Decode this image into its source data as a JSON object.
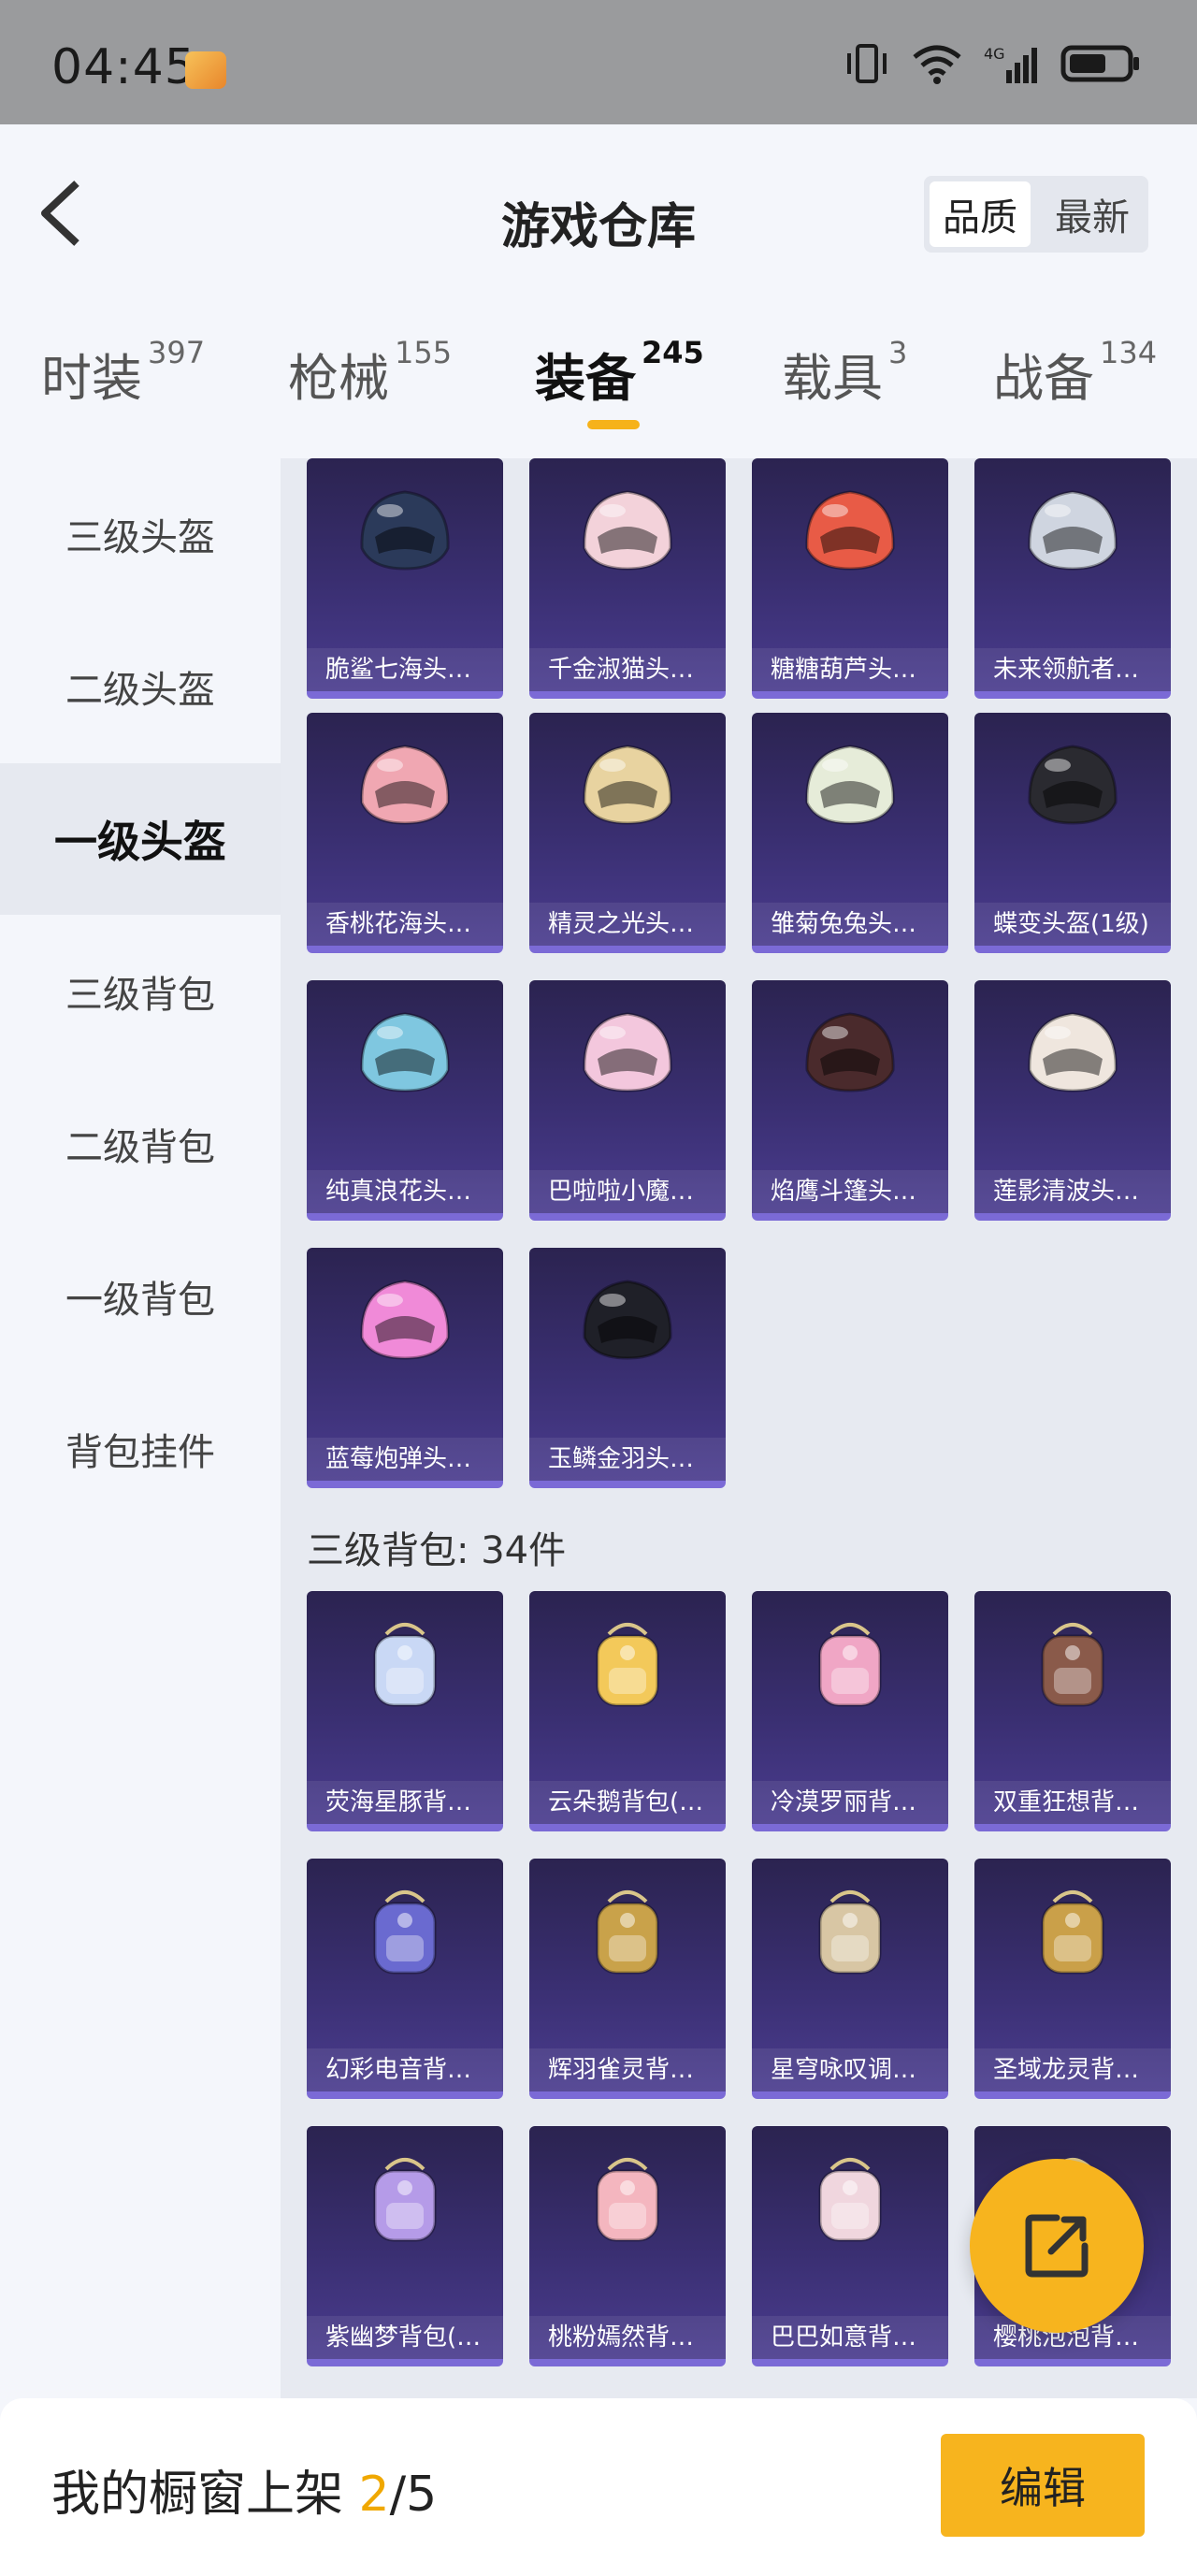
{
  "status_bar": {
    "time": "04:45"
  },
  "header": {
    "title": "游戏仓库",
    "sort_options": [
      "品质",
      "最新"
    ]
  },
  "tabs": [
    {
      "label": "时装",
      "count": "397"
    },
    {
      "label": "枪械",
      "count": "155"
    },
    {
      "label": "装备",
      "count": "245"
    },
    {
      "label": "载具",
      "count": "3"
    },
    {
      "label": "战备",
      "count": "134"
    }
  ],
  "sidebar": {
    "items": [
      "三级头盔",
      "二级头盔",
      "一级头盔",
      "三级背包",
      "二级背包",
      "一级背包",
      "背包挂件"
    ]
  },
  "helmets": [
    {
      "name": "脆鲨七海头…",
      "color": "#2b3a5a"
    },
    {
      "name": "千金淑猫头…",
      "color": "#f3d2da"
    },
    {
      "name": "糖糖葫芦头…",
      "color": "#e85b46"
    },
    {
      "name": "未来领航者…",
      "color": "#cfd5e0"
    },
    {
      "name": "香桃花海头…",
      "color": "#f0a7b2"
    },
    {
      "name": "精灵之光头…",
      "color": "#e8d3a0"
    },
    {
      "name": "雏菊兔兔头…",
      "color": "#e6ecd9"
    },
    {
      "name": "蝶变头盔(1级)",
      "color": "#2a2a30"
    },
    {
      "name": "纯真浪花头…",
      "color": "#7fc7e0"
    },
    {
      "name": "巴啦啦小魔…",
      "color": "#f3c7dd"
    },
    {
      "name": "焰鹰斗篷头…",
      "color": "#4a2a2c"
    },
    {
      "name": "莲影清波头…",
      "color": "#efe6de"
    },
    {
      "name": "蓝莓炮弹头…",
      "color": "#f08ad8"
    },
    {
      "name": "玉鳞金羽头…",
      "color": "#1f2028"
    }
  ],
  "backpack_section": {
    "label": "三级背包: 34件"
  },
  "backpacks": [
    {
      "name": "荧海星豚背…",
      "color": "#c9d8f5"
    },
    {
      "name": "云朵鹅背包(…",
      "color": "#f3c95a"
    },
    {
      "name": "冷漠罗丽背…",
      "color": "#f0a6c5"
    },
    {
      "name": "双重狂想背…",
      "color": "#8a5a4a"
    },
    {
      "name": "幻彩电音背…",
      "color": "#6a6ad0"
    },
    {
      "name": "辉羽雀灵背…",
      "color": "#c9a24a"
    },
    {
      "name": "星穹咏叹调…",
      "color": "#d8c6a4"
    },
    {
      "name": "圣域龙灵背…",
      "color": "#caa049"
    },
    {
      "name": "紫幽梦背包(…",
      "color": "#b59be8"
    },
    {
      "name": "桃粉嫣然背…",
      "color": "#f4b6bf"
    },
    {
      "name": "巴巴如意背…",
      "color": "#f0d6de"
    },
    {
      "name": "樱桃泡泡背…",
      "color": "#e5b7c7"
    }
  ],
  "bottom_bar": {
    "prefix": "我的橱窗上架",
    "current": "2",
    "total": "/5",
    "edit_label": "编辑"
  },
  "colors": {
    "accent": "#f7b41e",
    "card_bg": "#3a2f72"
  }
}
